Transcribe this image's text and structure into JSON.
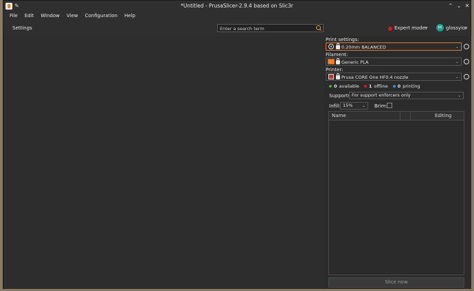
{
  "window": {
    "title": "*Untitled - PrusaSlicer-2.9.4 based on Slic3r",
    "controls": [
      "chevron-up-icon",
      "chevron-down-icon",
      "close-icon"
    ]
  },
  "menubar": {
    "items": [
      "File",
      "Edit",
      "Window",
      "View",
      "Configuration",
      "Help"
    ]
  },
  "toolbar": {
    "settings_label": "Settings",
    "search_placeholder": "Enter a search term",
    "mode_label": "Expert mode",
    "mode_color": "#e0141c",
    "user_initial": "M",
    "user_name": "glossyio",
    "avatar_color": "#1f9c89"
  },
  "sidebar": {
    "print_settings_label": "Print settings:",
    "print_settings_value": "0.20mm BALANCED",
    "filament_label": "Filament:",
    "filament_value": "Generic PLA",
    "filament_color": "#f58220",
    "printer_label": "Printer:",
    "printer_value": "Prusa CORE One HF0.4 nozzle",
    "status": {
      "available_count": "0",
      "available_label": "available",
      "available_color": "#3cb043",
      "offline_count": "1",
      "offline_label": "offline",
      "offline_color": "#e0141c",
      "printing_count": "0",
      "printing_label": "printing",
      "printing_color": "#2f8fdf"
    },
    "supports_label": "Supports:",
    "supports_value": "For support enforcers only",
    "infill_label": "Infill:",
    "infill_value": "15%",
    "brim_label": "Brim:",
    "brim_checked": false,
    "table_headers": [
      "Name",
      "Editing"
    ],
    "slice_button": "Slice now"
  }
}
